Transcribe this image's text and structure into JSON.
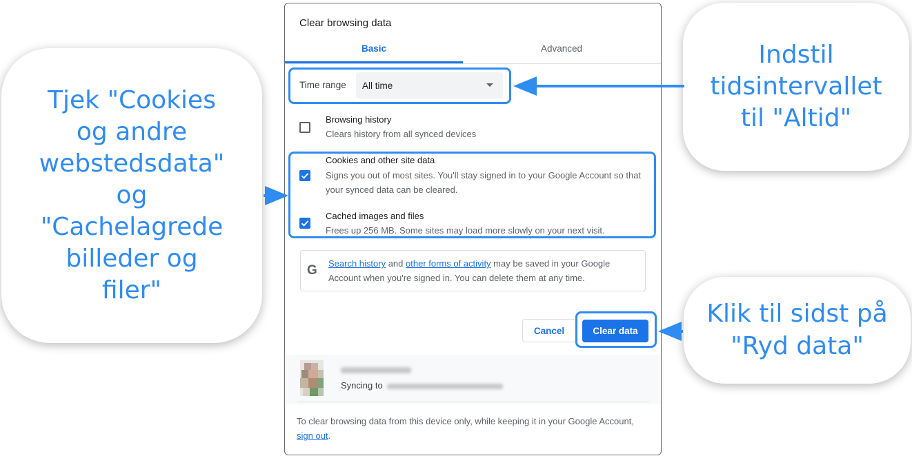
{
  "annotations": {
    "left": "Tjek \"Cookies\nog andre\nwebstedsdata\"\nog\n\"Cachelagrede\nbilleder og\nfiler\"",
    "top_right": "Indstil\ntidsintervallet\ntil \"Altid\"",
    "bottom_right": "Klik til sidst på\n\"Ryd data\""
  },
  "dialog": {
    "title": "Clear browsing data",
    "tabs": [
      {
        "label": "Basic",
        "selected": true
      },
      {
        "label": "Advanced",
        "selected": false
      }
    ],
    "time_range": {
      "label": "Time range",
      "value": "All time"
    },
    "options": [
      {
        "title": "Browsing history",
        "description": "Clears history from all synced devices",
        "checked": false
      },
      {
        "title": "Cookies and other site data",
        "description": "Signs you out of most sites. You'll stay signed in to your Google Account so that your synced data can be cleared.",
        "checked": true
      },
      {
        "title": "Cached images and files",
        "description": "Frees up 256 MB. Some sites may load more slowly on your next visit.",
        "checked": true
      }
    ],
    "info": {
      "link1": "Search history",
      "text1": " and ",
      "link2": "other forms of activity",
      "text2": " may be saved in your Google Account when you're signed in. You can delete them at any time."
    },
    "buttons": {
      "cancel": "Cancel",
      "clear": "Clear data"
    },
    "account": {
      "syncing_label": "Syncing to"
    },
    "footer": {
      "text": "To clear browsing data from this device only, while keeping it in your Google Account, ",
      "link": "sign out",
      "end": "."
    }
  },
  "colors": {
    "accent": "#1a73e8",
    "annotation": "#2f8cf0"
  }
}
